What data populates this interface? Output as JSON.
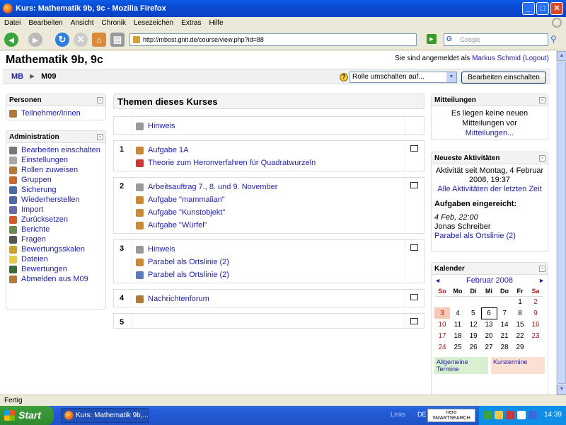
{
  "window": {
    "title": "Kurs: Mathematik 9b, 9c - Mozilla Firefox"
  },
  "menu": [
    "Datei",
    "Bearbeiten",
    "Ansicht",
    "Chronik",
    "Lesezeichen",
    "Extras",
    "Hilfe"
  ],
  "toolbar": {
    "url": "http://mbost.gnit.de/course/view.php?id=88",
    "search_placeholder": "Google"
  },
  "page": {
    "course_title": "Mathematik 9b, 9c",
    "login_text": "Sie sind angemeldet als",
    "login_user": "Markus Schmid",
    "logout": "(Logout)",
    "breadcrumb": {
      "home": "MB",
      "sep": "►",
      "current": "M09"
    },
    "role_select": "Rolle umschalten auf...",
    "edit_button": "Bearbeiten einschalten"
  },
  "left": {
    "personen": {
      "title": "Personen",
      "items": [
        "Teilnehmer/innen"
      ]
    },
    "admin": {
      "title": "Administration",
      "items": [
        "Bearbeiten einschalten",
        "Einstellungen",
        "Rollen zuweisen",
        "Gruppen",
        "Sicherung",
        "Wiederherstellen",
        "Import",
        "Zurücksetzen",
        "Berichte",
        "Fragen",
        "Bewertungsskalen",
        "Dateien",
        "Bewertungen",
        "Abmelden aus M09"
      ]
    }
  },
  "center": {
    "title": "Themen dieses Kurses",
    "sections": [
      {
        "num": "",
        "items": [
          "Hinweis"
        ]
      },
      {
        "num": "1",
        "items": [
          "Aufgabe 1A",
          "Theorie zum Heronverfahren für Quadratwurzeln"
        ]
      },
      {
        "num": "2",
        "items": [
          "Arbeitsauftrag 7., 8. und 9. November",
          "Aufgabe \"mammalian\"",
          "Aufgabe \"Kunstobjekt\"",
          "Aufgabe \"Würfel\""
        ]
      },
      {
        "num": "3",
        "items": [
          "Hinweis",
          "Parabel als Ortslinie (2)",
          "Parabel als Ortslinie (2)"
        ]
      },
      {
        "num": "4",
        "items": [
          "Nachrichtenforum"
        ]
      },
      {
        "num": "5",
        "items": []
      }
    ]
  },
  "right": {
    "news": {
      "title": "Mitteilungen",
      "line1": "Es liegen keine neuen",
      "line2": "Mitteilungen vor",
      "link": "Mitteilungen..."
    },
    "activity": {
      "title": "Neueste Aktivitäten",
      "since1": "Aktivität seit Montag, 4 Februar",
      "since2": "2008, 19:37",
      "all_link": "Alle Aktivitäten der letzten Zeit",
      "submitted_title": "Aufgaben eingereicht:",
      "date": "4 Feb, 22:00",
      "person": "Jonas Schreiber",
      "task": "Parabel als Ortslinie (2)"
    },
    "calendar": {
      "title": "Kalender",
      "month": "Februar 2008",
      "prev": "◄",
      "next": "►",
      "days": [
        "So",
        "Mo",
        "Di",
        "Mi",
        "Do",
        "Fr",
        "Sa"
      ],
      "weeks": [
        [
          "",
          "",
          "",
          "",
          "",
          "1",
          "2"
        ],
        [
          "3",
          "4",
          "5",
          "6",
          "7",
          "8",
          "9"
        ],
        [
          "10",
          "11",
          "12",
          "13",
          "14",
          "15",
          "16"
        ],
        [
          "17",
          "18",
          "19",
          "20",
          "21",
          "22",
          "23"
        ],
        [
          "24",
          "25",
          "26",
          "27",
          "28",
          "29",
          ""
        ]
      ],
      "legend_general": "Allgemeine Termine",
      "legend_course": "Kurstermine"
    }
  },
  "status": "Fertig",
  "taskbar": {
    "start": "Start",
    "task": "Kurs: Mathematik 9b,...",
    "links": "Links",
    "lang": "DE",
    "nero": "nero SMARTSEARCH",
    "clock": "14:39"
  }
}
